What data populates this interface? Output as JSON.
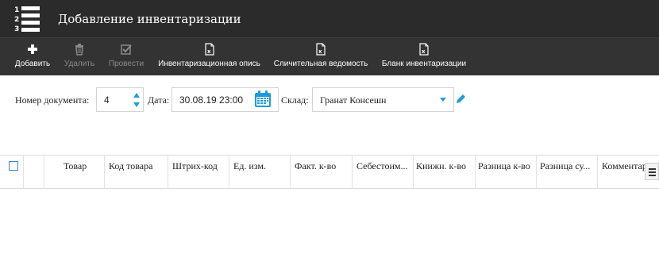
{
  "header": {
    "title": "Добавление инвентаризации",
    "logo_digits": [
      "1",
      "2",
      "3"
    ]
  },
  "toolbar": [
    {
      "label": "Добавить",
      "icon": "plus-icon",
      "enabled": true
    },
    {
      "label": "Удалить",
      "icon": "trash-icon",
      "enabled": false
    },
    {
      "label": "Провести",
      "icon": "checkbox-icon",
      "enabled": false
    },
    {
      "label": "Инвентаризационная опись",
      "icon": "excel-file-icon",
      "enabled": true
    },
    {
      "label": "Сличительная ведомость",
      "icon": "excel-file-icon",
      "enabled": true
    },
    {
      "label": "Бланк инвентаризации",
      "icon": "excel-file-icon",
      "enabled": true
    }
  ],
  "form": {
    "doc_number_label": "Номер документа:",
    "doc_number_value": "4",
    "date_label": "Дата:",
    "date_value": "30.08.19 23:00",
    "warehouse_label": "Склад:",
    "warehouse_value": "Гранат Консешн"
  },
  "grid": {
    "columns": [
      "Товар",
      "Код товара",
      "Штрих-код",
      "Ед. изм.",
      "Факт. к-во",
      "Себестоим...",
      "Книжн. к-во",
      "Разница к-во",
      "Разница су...",
      "Комментар"
    ]
  },
  "colors": {
    "header_bg": "#2b2b2b",
    "toolbar_bg": "#333333",
    "accent": "#1e9bd7"
  }
}
